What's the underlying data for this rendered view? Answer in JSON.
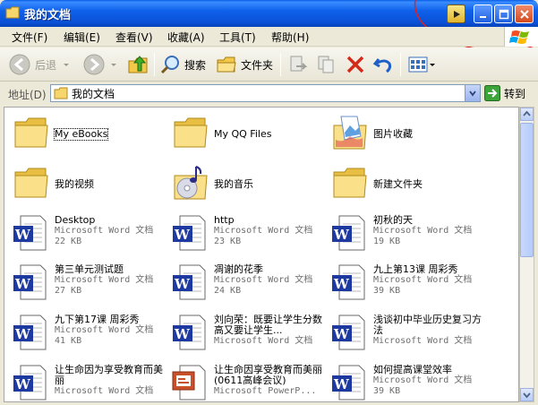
{
  "window": {
    "title": "我的文档"
  },
  "menu": [
    "文件(F)",
    "编辑(E)",
    "查看(V)",
    "收藏(A)",
    "工具(T)",
    "帮助(H)"
  ],
  "toolbar": {
    "back": "后退",
    "search": "搜索",
    "folders": "文件夹"
  },
  "address": {
    "label": "地址(D)",
    "value": "我的文档",
    "go": "转到"
  },
  "items": [
    {
      "name": "My eBooks",
      "kind": "folder"
    },
    {
      "name": "My QQ Files",
      "kind": "folder"
    },
    {
      "name": "图片收藏",
      "kind": "pictures"
    },
    {
      "name": "我的视频",
      "kind": "folder"
    },
    {
      "name": "我的音乐",
      "kind": "music"
    },
    {
      "name": "新建文件夹",
      "kind": "folder"
    },
    {
      "name": "Desktop",
      "kind": "word",
      "type": "Microsoft Word 文档",
      "size": "22 KB"
    },
    {
      "name": "http",
      "kind": "word",
      "type": "Microsoft Word 文档",
      "size": "23 KB"
    },
    {
      "name": "初秋的天",
      "kind": "word",
      "type": "Microsoft Word 文档",
      "size": "19 KB"
    },
    {
      "name": "第三单元测试题",
      "kind": "word",
      "type": "Microsoft Word 文档",
      "size": "27 KB"
    },
    {
      "name": "凋谢的花季",
      "kind": "word",
      "type": "Microsoft Word 文档",
      "size": "24 KB"
    },
    {
      "name": "九上第13课 周彩秀",
      "kind": "word",
      "type": "Microsoft Word 文档",
      "size": "39 KB"
    },
    {
      "name": "九下第17课 周彩秀",
      "kind": "word",
      "type": "Microsoft Word 文档",
      "size": "41 KB"
    },
    {
      "name": "刘向荣：既要让学生分数高又要让学生...",
      "kind": "word",
      "type": "Microsoft Word 文档",
      "size": ""
    },
    {
      "name": "浅谈初中毕业历史复习方法",
      "kind": "word",
      "type": "Microsoft Word 文档",
      "size": ""
    },
    {
      "name": "让生命因为享受教育而美丽",
      "kind": "word",
      "type": "Microsoft Word 文档",
      "size": ""
    },
    {
      "name": "让生命因享受教育而美丽(0611高峰会议)",
      "kind": "ppt",
      "type": "Microsoft PowerP...",
      "size": ""
    },
    {
      "name": "如何提高课堂效率",
      "kind": "word",
      "type": "Microsoft Word 文档",
      "size": "39 KB"
    }
  ]
}
